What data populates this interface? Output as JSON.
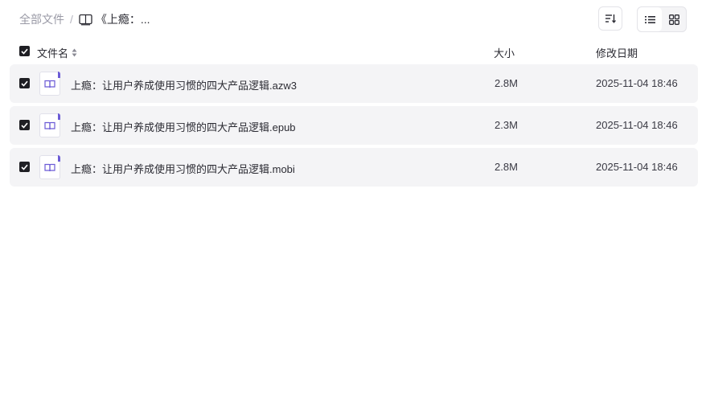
{
  "breadcrumb": {
    "root": "全部文件",
    "separator": "/",
    "current": "《上瘾：..."
  },
  "toolbar": {
    "sort_icon": "sort-icon",
    "list_view_icon": "list-view-icon",
    "grid_view_icon": "grid-view-icon",
    "active_view": "list"
  },
  "table": {
    "headers": {
      "name": "文件名",
      "size": "大小",
      "date": "修改日期"
    },
    "rows": [
      {
        "name": "上瘾：让用户养成使用习惯的四大产品逻辑.azw3",
        "size": "2.8M",
        "date": "2025-11-04 18:46",
        "checked": true
      },
      {
        "name": "上瘾：让用户养成使用习惯的四大产品逻辑.epub",
        "size": "2.3M",
        "date": "2025-11-04 18:46",
        "checked": true
      },
      {
        "name": "上瘾：让用户养成使用习惯的四大产品逻辑.mobi",
        "size": "2.8M",
        "date": "2025-11-04 18:46",
        "checked": true
      }
    ]
  },
  "colors": {
    "accent": "#6b5bd6",
    "row_bg": "#f4f4f6",
    "checkbox": "#1f1f24"
  }
}
